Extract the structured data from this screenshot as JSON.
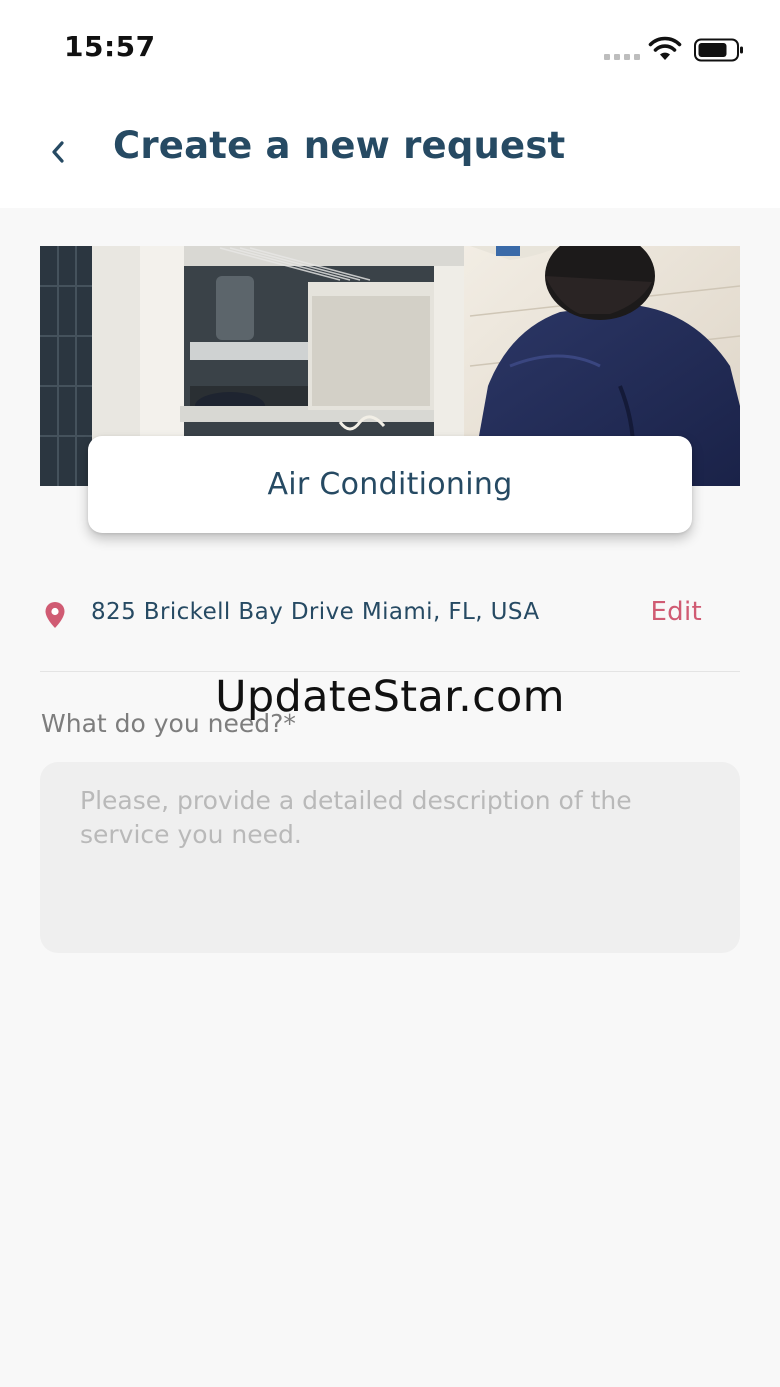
{
  "status_bar": {
    "time": "15:57",
    "icons": [
      "cellular-signal-icon",
      "wifi-icon",
      "battery-icon"
    ]
  },
  "header": {
    "back_icon": "chevron-left-icon",
    "title": "Create a new request"
  },
  "hero": {
    "category_label": "Air Conditioning"
  },
  "location": {
    "icon": "map-pin-icon",
    "address": "825 Brickell Bay Drive Miami, FL, USA",
    "edit_label": "Edit"
  },
  "watermark": "UpdateStar.com",
  "request_form": {
    "field_label": "What do you need?*",
    "description_value": "",
    "description_placeholder": "Please, provide a detailed description of the service you need."
  },
  "colors": {
    "title_text": "#264a63",
    "accent": "#d05b73",
    "background": "#f8f8f8",
    "input_background": "#efefef"
  }
}
